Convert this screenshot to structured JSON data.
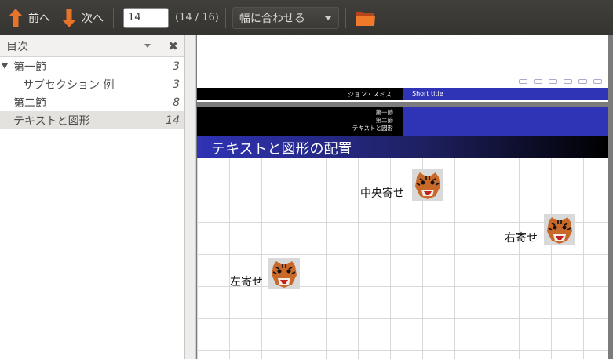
{
  "toolbar": {
    "prev_label": "前へ",
    "next_label": "次へ",
    "page_value": "14",
    "page_count": "(14 / 16)",
    "zoom_value": "幅に合わせる"
  },
  "sidebar": {
    "title": "目次",
    "items": [
      {
        "label": "第一節",
        "page": "3"
      },
      {
        "label": "サブセクション 例",
        "page": "3"
      },
      {
        "label": "第二節",
        "page": "8"
      },
      {
        "label": "テキストと図形",
        "page": "14"
      }
    ]
  },
  "slide_prev": {
    "footer_author": "ジョン・スミス",
    "footer_title": "Short title"
  },
  "slide": {
    "nav_lines": [
      "第一節",
      "第二節",
      "テキストと図形"
    ],
    "frame_title": "テキストと図形の配置",
    "captions": {
      "center": "中央寄せ",
      "right": "右寄せ",
      "left": "左寄せ"
    }
  },
  "colors": {
    "beamer_blue": "#2f33b5",
    "toolbar_bg": "#3c3b37",
    "arrow_orange": "#e8742b"
  },
  "icons": {
    "prev": "arrow-up-icon",
    "next": "arrow-down-icon",
    "folder": "folder-icon",
    "close": "close-icon",
    "tiger": "tiger-head-image"
  }
}
